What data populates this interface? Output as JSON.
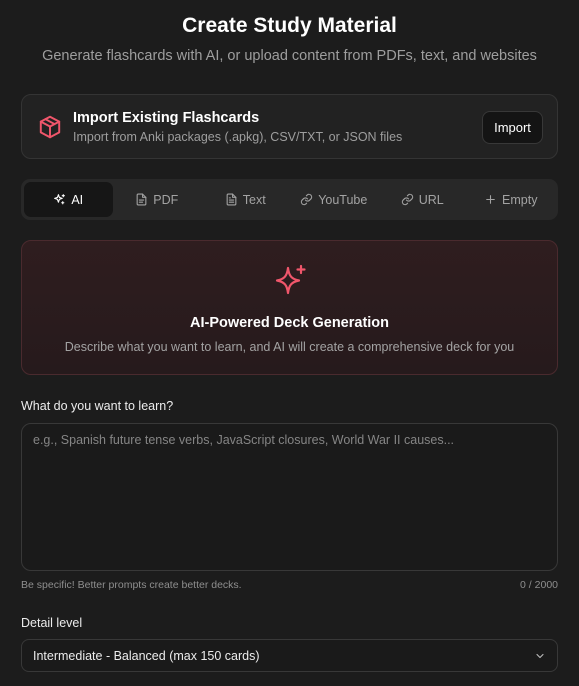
{
  "header": {
    "title": "Create Study Material",
    "subtitle": "Generate flashcards with AI, or upload content from PDFs, text, and websites"
  },
  "import_card": {
    "icon": "package-icon",
    "title": "Import Existing Flashcards",
    "description": "Import from Anki packages (.apkg), CSV/TXT, or JSON files",
    "button_label": "Import"
  },
  "tabs": [
    {
      "icon": "sparkles-icon",
      "label": "AI",
      "active": true
    },
    {
      "icon": "file-icon",
      "label": "PDF",
      "active": false
    },
    {
      "icon": "file-text-icon",
      "label": "Text",
      "active": false
    },
    {
      "icon": "link-icon",
      "label": "YouTube",
      "active": false
    },
    {
      "icon": "link-icon",
      "label": "URL",
      "active": false
    },
    {
      "icon": "plus-icon",
      "label": "Empty",
      "active": false
    }
  ],
  "hero": {
    "icon": "sparkles-icon",
    "title": "AI-Powered Deck Generation",
    "description": "Describe what you want to learn, and AI will create a comprehensive deck for you"
  },
  "prompt": {
    "label": "What do you want to learn?",
    "value": "",
    "placeholder": "e.g., Spanish future tense verbs, JavaScript closures, World War II causes...",
    "hint": "Be specific! Better prompts create better decks.",
    "char_count": "0 / 2000"
  },
  "detail": {
    "label": "Detail level",
    "selected": "Intermediate - Balanced (max 150 cards)"
  },
  "colors": {
    "accent": "#f0566b",
    "background": "#1c1c1c"
  }
}
